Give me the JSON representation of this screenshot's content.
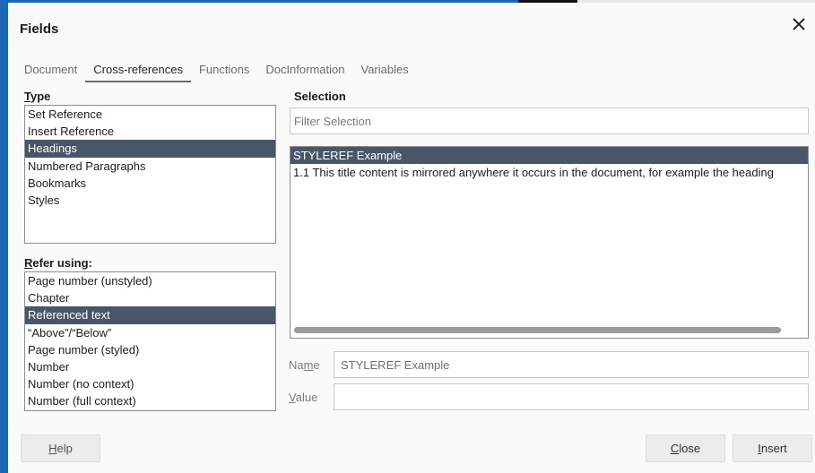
{
  "dialog": {
    "title": "Fields"
  },
  "tabs": [
    {
      "label": "Document",
      "active": false
    },
    {
      "label": "Cross-references",
      "active": true
    },
    {
      "label": "Functions",
      "active": false
    },
    {
      "label": "DocInformation",
      "active": false
    },
    {
      "label": "Variables",
      "active": false
    }
  ],
  "type": {
    "label_mnemonic": "T",
    "label_rest": "ype",
    "items": [
      "Set Reference",
      "Insert Reference",
      "Headings",
      "Numbered Paragraphs",
      "Bookmarks",
      "Styles"
    ],
    "selected": "Headings"
  },
  "refer_using": {
    "label_mnemonic": "R",
    "label_rest": "efer using:",
    "items": [
      "Page number (unstyled)",
      "Chapter",
      "Referenced text",
      "“Above”/“Below”",
      "Page number (styled)",
      "Number",
      "Number (no context)",
      "Number (full context)"
    ],
    "selected": "Referenced text"
  },
  "selection": {
    "label": "Selection",
    "filter_placeholder": "Filter Selection",
    "items": [
      "STYLEREF Example",
      "1.1 This title content is mirrored anywhere it occurs in the document, for example the heading"
    ],
    "selected": "STYLEREF Example"
  },
  "name_field": {
    "label_pre": "Na",
    "label_mnemonic": "m",
    "label_post": "e",
    "value": "STYLEREF Example"
  },
  "value_field": {
    "label_mnemonic": "V",
    "label_post": "alue",
    "value": ""
  },
  "buttons": {
    "help_mnemonic": "H",
    "help_rest": "elp",
    "close_mnemonic": "C",
    "close_rest": "lose",
    "insert_mnemonic": "I",
    "insert_rest": "nsert"
  },
  "colors": {
    "selection_highlight": "#4a5569",
    "desktop_accent": "#1d66b5"
  },
  "icons": {
    "close": "close-icon"
  }
}
